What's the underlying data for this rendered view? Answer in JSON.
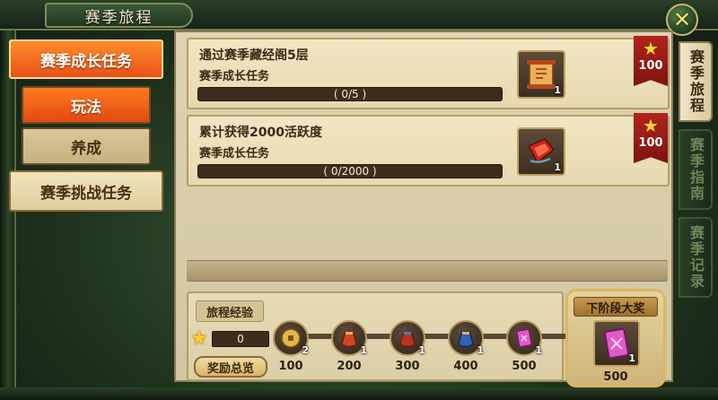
{
  "window": {
    "title": "赛季旅程",
    "close_icon": "✕"
  },
  "left_menu": {
    "items": [
      {
        "label": "赛季成长任务",
        "state": "active"
      },
      {
        "label": "玩法",
        "state": "active-sub"
      },
      {
        "label": "养成",
        "state": "inactive-sub"
      },
      {
        "label": "赛季挑战任务",
        "state": "inactive"
      }
    ]
  },
  "tasks": [
    {
      "title": "通过赛季藏经阁5层",
      "subtitle": "赛季成长任务",
      "progress_text": "( 0/5 )",
      "progress": 0,
      "item_icon": "scroll-icon",
      "item_count": "1",
      "reward": "100"
    },
    {
      "title": "累计获得2000活跃度",
      "subtitle": "赛季成长任务",
      "progress_text": "( 0/2000 )",
      "progress": 0,
      "item_icon": "red-gem-icon",
      "item_count": "1",
      "reward": "100"
    }
  ],
  "journey": {
    "label": "旅程经验",
    "xp": "0",
    "rewards_button": "奖励总览",
    "nodes": [
      {
        "icon": "coin-icon",
        "count": "2",
        "value": "100",
        "color": "#c9a24a"
      },
      {
        "icon": "red-pouch-icon",
        "count": "1",
        "value": "200",
        "color": "#c8441e"
      },
      {
        "icon": "red-pouch-icon",
        "count": "1",
        "value": "300",
        "color": "#b8361a"
      },
      {
        "icon": "blue-pouch-icon",
        "count": "1",
        "value": "400",
        "color": "#2e62b8"
      },
      {
        "icon": "pink-scroll-icon",
        "count": "1",
        "value": "500",
        "color": "#d04ab8"
      }
    ]
  },
  "next_stage": {
    "title": "下阶段大奖",
    "icon": "pink-scroll-icon",
    "count": "1",
    "value": "500"
  },
  "right_tabs": [
    {
      "label": "赛季旅程",
      "state": "active"
    },
    {
      "label": "赛季指南",
      "state": "inactive"
    },
    {
      "label": "赛季记录",
      "state": "inactive"
    }
  ]
}
